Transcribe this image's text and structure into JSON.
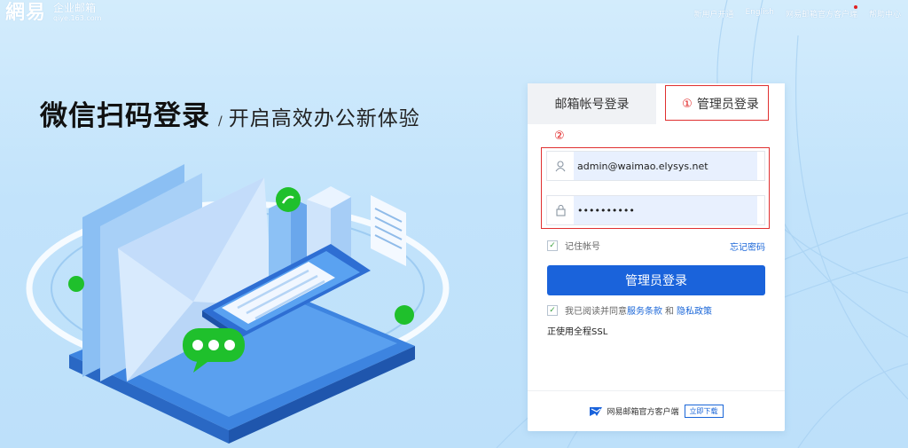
{
  "brand": {
    "logo": "網易",
    "name": "企业邮箱",
    "url": "qiye.163.com"
  },
  "top_nav": {
    "items": [
      "新用户开通",
      "English",
      "网易邮箱官方客户端",
      "帮助中心"
    ],
    "notify_color": "#e02020"
  },
  "headline": {
    "main": "微信扫码登录",
    "separator": "/",
    "sub": "开启高效办公新体验"
  },
  "login": {
    "tabs": {
      "account": "邮箱帐号登录",
      "admin": "管理员登录",
      "admin_marker": "①"
    },
    "fields_marker": "②",
    "username": {
      "value": "admin@waimao.elysys.net",
      "icon": "user-icon"
    },
    "password": {
      "value": "••••••••••",
      "icon": "lock-icon"
    },
    "remember_label": "记住帐号",
    "forgot_label": "忘记密码",
    "submit_label": "管理员登录",
    "agree": {
      "prefix": "我已阅读并同意",
      "terms": "服务条款",
      "and": "和",
      "privacy": "隐私政策"
    },
    "ssl_label": "正使用全程SSL",
    "footer": {
      "client_label": "网易邮箱官方客户端",
      "download_label": "立即下载"
    }
  },
  "colors": {
    "primary": "#1a63db",
    "link": "#1a66d8",
    "highlight": "#e03030",
    "accent_green": "#1fc02c"
  }
}
